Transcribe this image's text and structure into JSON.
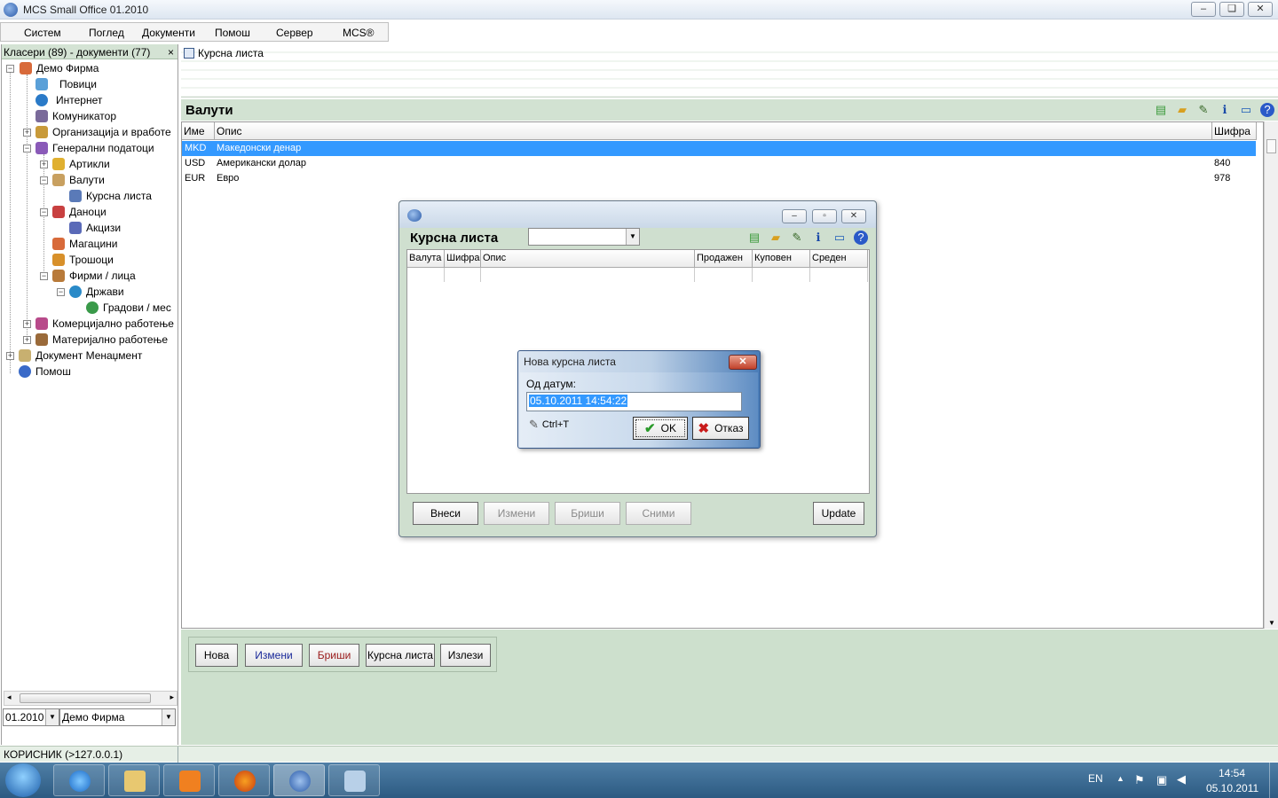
{
  "window": {
    "title": "MCS Small Office 01.2010"
  },
  "menu": [
    "Систем",
    "Поглед",
    "Документи",
    "Помош",
    "Сервер",
    "MCS®"
  ],
  "left_pane": {
    "header": "Класери (89) - документи (77)",
    "close": "×",
    "tree": [
      "Демо Фирма",
      "Повици",
      "Интернет",
      "Комуникатор",
      "Организација и вработе",
      "Генерални податоци",
      "Артикли",
      "Валути",
      "Курсна листа",
      "Даноци",
      "Акцизи",
      "Магацини",
      "Трошоци",
      "Фирми / лица",
      "Држави",
      "Градови / мес",
      "Комерцијално работење",
      "Материјално работење",
      "Документ Менаџмент",
      "Помош"
    ],
    "year": "01.2010",
    "company": "Демо Фирма"
  },
  "tab": {
    "label": "Курсна листа"
  },
  "valuti": {
    "title": "Валути",
    "columns": [
      "Име",
      "Опис",
      "Шифра"
    ],
    "rows": [
      {
        "name": "MKD",
        "desc": "Македонски денар",
        "code": ""
      },
      {
        "name": "USD",
        "desc": "Американски долар",
        "code": "840"
      },
      {
        "name": "EUR",
        "desc": "Евро",
        "code": "978"
      }
    ],
    "buttons": [
      "Нова",
      "Измени",
      "Бриши",
      "Курсна листа",
      "Излези"
    ]
  },
  "kursna": {
    "title": "Курсна листа",
    "columns": [
      "Валута",
      "Шифра",
      "Опис",
      "Продажен",
      "Куповен",
      "Среден"
    ],
    "buttons": [
      "Внеси",
      "Измени",
      "Бриши",
      "Сними",
      "Update"
    ]
  },
  "dialog": {
    "title": "Нова курсна листа",
    "label": "Од датум:",
    "value": "05.10.2011 14:54:22",
    "hint": "Ctrl+T",
    "ok": "OK",
    "cancel": "Отказ"
  },
  "status": {
    "text": "КОРИСНИК (>127.0.0.1)"
  },
  "taskbar": {
    "lang": "EN",
    "time": "14:54",
    "date": "05.10.2011"
  },
  "colors": {
    "selection": "#3399ff",
    "panel_green": "#d2e2d2"
  }
}
